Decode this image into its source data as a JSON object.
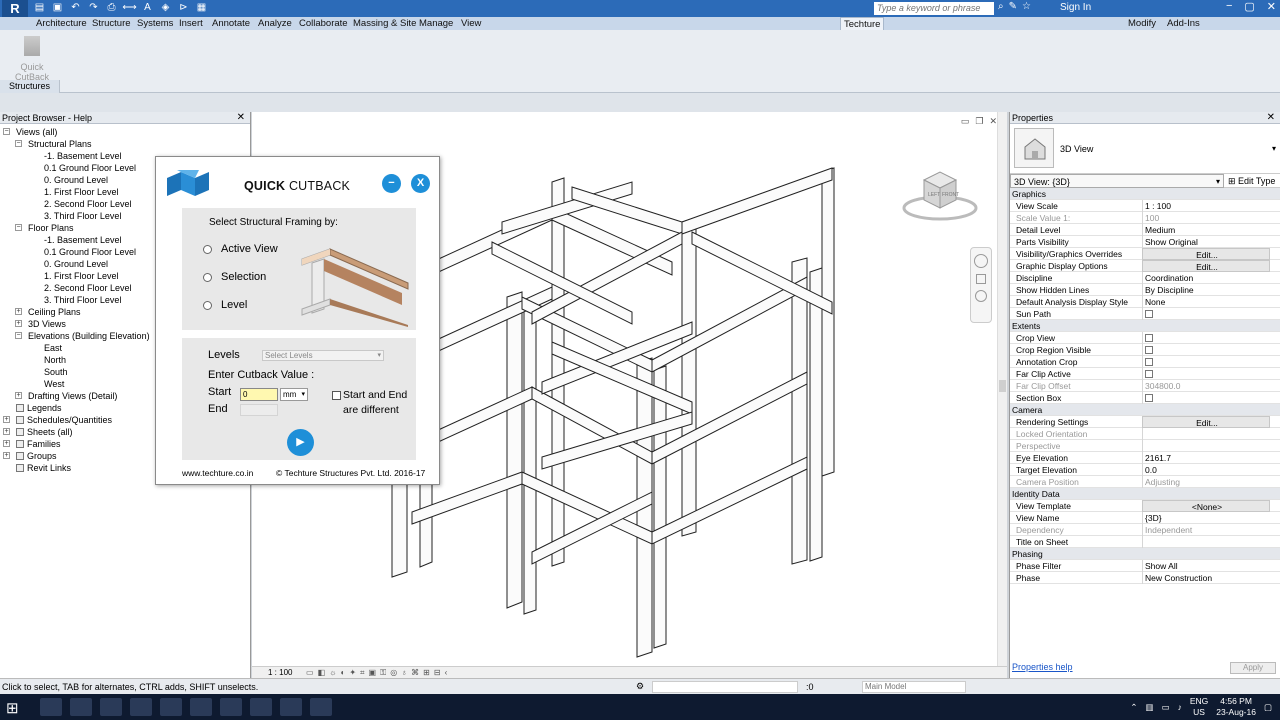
{
  "titlebar": {
    "logo": "R",
    "search_placeholder": "Type a keyword or phrase",
    "sign_in": "Sign In"
  },
  "ribbon": {
    "tabs": [
      "Architecture",
      "Structure",
      "Systems",
      "Insert",
      "Annotate",
      "Analyze",
      "Collaborate",
      "Massing & Site",
      "Manage",
      "View",
      "Techture",
      "Modify",
      "Add-Ins"
    ],
    "active_tab": "Techture",
    "tool_label": "Quick CutBack",
    "group_label": "Structures"
  },
  "project_browser": {
    "title": "Project Browser - Help",
    "close": "✕",
    "tree": [
      {
        "label": "Views (all)",
        "level": 0,
        "exp": "−"
      },
      {
        "label": "Structural Plans",
        "level": 1,
        "exp": "−"
      },
      {
        "label": "-1. Basement Level",
        "level": 2
      },
      {
        "label": "0.1 Ground Floor Level",
        "level": 2
      },
      {
        "label": "0. Ground Level",
        "level": 2
      },
      {
        "label": "1. First Floor Level",
        "level": 2
      },
      {
        "label": "2. Second Floor Level",
        "level": 2
      },
      {
        "label": "3. Third Floor Level",
        "level": 2
      },
      {
        "label": "Floor Plans",
        "level": 1,
        "exp": "−"
      },
      {
        "label": "-1. Basement Level",
        "level": 2
      },
      {
        "label": "0.1 Ground Floor Level",
        "level": 2
      },
      {
        "label": "0. Ground Level",
        "level": 2
      },
      {
        "label": "1. First Floor Level",
        "level": 2
      },
      {
        "label": "2. Second Floor Level",
        "level": 2
      },
      {
        "label": "3. Third Floor Level",
        "level": 2
      },
      {
        "label": "Ceiling Plans",
        "level": 1,
        "exp": "+"
      },
      {
        "label": "3D Views",
        "level": 1,
        "exp": "+"
      },
      {
        "label": "Elevations (Building Elevation)",
        "level": 1,
        "exp": "−"
      },
      {
        "label": "East",
        "level": 2
      },
      {
        "label": "North",
        "level": 2
      },
      {
        "label": "South",
        "level": 2
      },
      {
        "label": "West",
        "level": 2
      },
      {
        "label": "Drafting Views (Detail)",
        "level": 1,
        "exp": "+"
      },
      {
        "label": "Legends",
        "level": 0,
        "icon": true
      },
      {
        "label": "Schedules/Quantities",
        "level": 0,
        "exp": "+",
        "icon": true
      },
      {
        "label": "Sheets (all)",
        "level": 0,
        "exp": "+",
        "icon": true
      },
      {
        "label": "Families",
        "level": 0,
        "exp": "+",
        "icon": true
      },
      {
        "label": "Groups",
        "level": 0,
        "exp": "+",
        "icon": true
      },
      {
        "label": "Revit Links",
        "level": 0,
        "icon": true
      }
    ]
  },
  "dialog": {
    "title_bold": "QUICK",
    "title_rest": " CUTBACK",
    "minimize": "−",
    "close": "X",
    "select_title": "Select Structural Framing by:",
    "options": [
      "Active View",
      "Selection",
      "Level"
    ],
    "levels_label": "Levels",
    "levels_placeholder": "Select Levels",
    "cutback_title": "Enter Cutback Value :",
    "start_label": "Start",
    "end_label": "End",
    "start_value": "0",
    "unit": "mm",
    "different_line1": "Start and End",
    "different_line2": "are different",
    "play": "▶",
    "website": "www.techture.co.in",
    "copyright": "© Techture Structures Pvt. Ltd. 2016-17"
  },
  "viewport": {
    "scale": "1 : 100",
    "viewcube_left": "LEFT",
    "viewcube_front": "FRONT"
  },
  "properties": {
    "title": "Properties",
    "close": "✕",
    "type_name": "3D View",
    "selector": "3D View: {3D}",
    "edit_type": "Edit Type",
    "rows": [
      {
        "group": "Graphics"
      },
      {
        "k": "View Scale",
        "v": "1 : 100"
      },
      {
        "k": "Scale Value    1:",
        "v": "100",
        "dim": true
      },
      {
        "k": "Detail Level",
        "v": "Medium"
      },
      {
        "k": "Parts Visibility",
        "v": "Show Original"
      },
      {
        "k": "Visibility/Graphics Overrides",
        "v": "Edit...",
        "btn": true
      },
      {
        "k": "Graphic Display Options",
        "v": "Edit...",
        "btn": true
      },
      {
        "k": "Discipline",
        "v": "Coordination"
      },
      {
        "k": "Show Hidden Lines",
        "v": "By Discipline"
      },
      {
        "k": "Default Analysis Display Style",
        "v": "None"
      },
      {
        "k": "Sun Path",
        "cb": true
      },
      {
        "group": "Extents"
      },
      {
        "k": "Crop View",
        "cb": true
      },
      {
        "k": "Crop Region Visible",
        "cb": true
      },
      {
        "k": "Annotation Crop",
        "cb": true
      },
      {
        "k": "Far Clip Active",
        "cb": true
      },
      {
        "k": "Far Clip Offset",
        "v": "304800.0",
        "dim": true
      },
      {
        "k": "Section Box",
        "cb": true
      },
      {
        "group": "Camera"
      },
      {
        "k": "Rendering Settings",
        "v": "Edit...",
        "btn": true
      },
      {
        "k": "Locked Orientation",
        "dim": true
      },
      {
        "k": "Perspective",
        "dim": true
      },
      {
        "k": "Eye Elevation",
        "v": "2161.7"
      },
      {
        "k": "Target Elevation",
        "v": "0.0"
      },
      {
        "k": "Camera Position",
        "v": "Adjusting",
        "dim": true
      },
      {
        "group": "Identity Data"
      },
      {
        "k": "View Template",
        "v": "<None>",
        "btn": true
      },
      {
        "k": "View Name",
        "v": "{3D}"
      },
      {
        "k": "Dependency",
        "v": "Independent",
        "dim": true
      },
      {
        "k": "Title on Sheet",
        "v": ""
      },
      {
        "group": "Phasing"
      },
      {
        "k": "Phase Filter",
        "v": "Show All"
      },
      {
        "k": "Phase",
        "v": "New Construction"
      }
    ],
    "help_link": "Properties help",
    "apply": "Apply"
  },
  "statusbar": {
    "text": "Click to select, TAB for alternates, CTRL adds, SHIFT unselects.",
    "zero": ":0",
    "model": "Main Model"
  },
  "taskbar": {
    "lang1": "ENG",
    "lang2": "US",
    "time": "4:56 PM",
    "date": "23-Aug-16"
  }
}
